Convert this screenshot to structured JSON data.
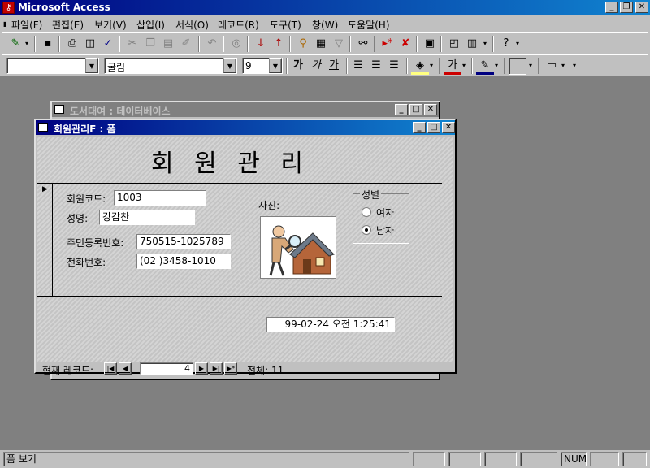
{
  "app": {
    "title": "Microsoft Access"
  },
  "menu": [
    "파일(F)",
    "편집(E)",
    "보기(V)",
    "삽입(I)",
    "서식(O)",
    "레코드(R)",
    "도구(T)",
    "창(W)",
    "도움말(H)"
  ],
  "toolbar2": {
    "object_combo": "",
    "font_combo": "굴림",
    "size_combo": "9",
    "bold": "가",
    "italic": "가",
    "underline": "가",
    "font_color": "가"
  },
  "back_window": {
    "title": "도서대여 : 데이터베이스"
  },
  "form": {
    "window_title": "회원관리F : 폼",
    "heading": "회 원 관 리",
    "member_code_label": "회원코드:",
    "member_code": "1003",
    "name_label": "성명:",
    "name": "강감찬",
    "ssn_label": "주민등록번호:",
    "ssn": "750515-1025789",
    "phone_label": "전화번호:",
    "phone": "(02 )3458-1010",
    "photo_label": "사진:",
    "gender": {
      "title": "성별",
      "female": "여자",
      "male": "남자",
      "selected": "남자"
    },
    "datetime": "99-02-24 오전 1:25:41"
  },
  "nav": {
    "label": "현재 레코드:",
    "current": "4",
    "total_label": "전체: 11"
  },
  "status": {
    "left": "폼 보기",
    "num": "NUM"
  }
}
